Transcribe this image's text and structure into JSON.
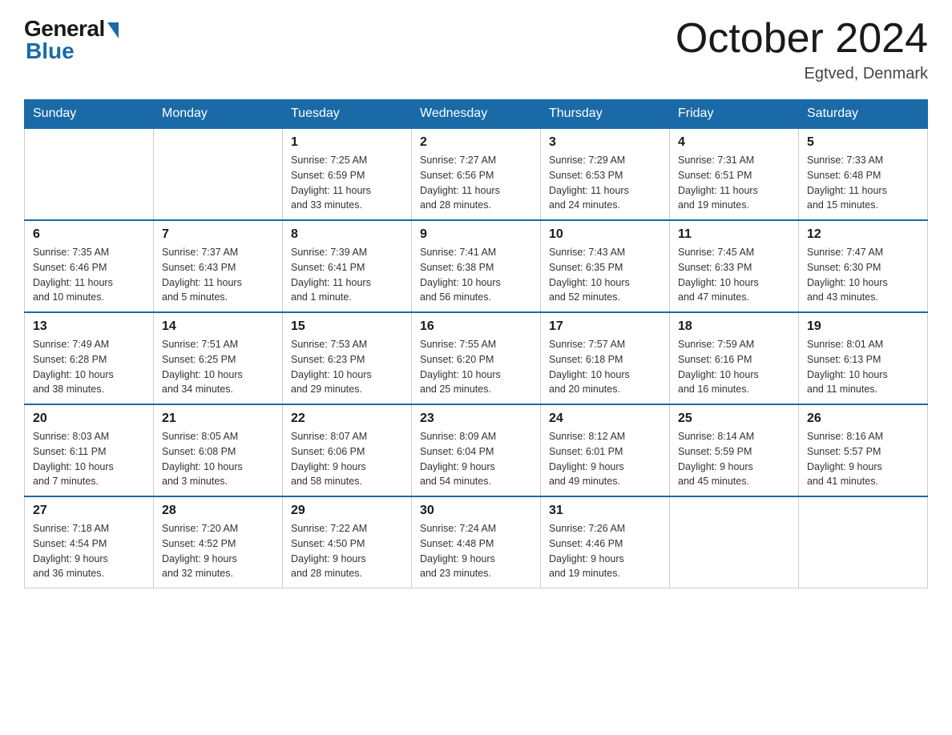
{
  "logo": {
    "general": "General",
    "blue": "Blue"
  },
  "title": "October 2024",
  "location": "Egtved, Denmark",
  "headers": [
    "Sunday",
    "Monday",
    "Tuesday",
    "Wednesday",
    "Thursday",
    "Friday",
    "Saturday"
  ],
  "weeks": [
    [
      {
        "day": "",
        "info": ""
      },
      {
        "day": "",
        "info": ""
      },
      {
        "day": "1",
        "info": "Sunrise: 7:25 AM\nSunset: 6:59 PM\nDaylight: 11 hours\nand 33 minutes."
      },
      {
        "day": "2",
        "info": "Sunrise: 7:27 AM\nSunset: 6:56 PM\nDaylight: 11 hours\nand 28 minutes."
      },
      {
        "day": "3",
        "info": "Sunrise: 7:29 AM\nSunset: 6:53 PM\nDaylight: 11 hours\nand 24 minutes."
      },
      {
        "day": "4",
        "info": "Sunrise: 7:31 AM\nSunset: 6:51 PM\nDaylight: 11 hours\nand 19 minutes."
      },
      {
        "day": "5",
        "info": "Sunrise: 7:33 AM\nSunset: 6:48 PM\nDaylight: 11 hours\nand 15 minutes."
      }
    ],
    [
      {
        "day": "6",
        "info": "Sunrise: 7:35 AM\nSunset: 6:46 PM\nDaylight: 11 hours\nand 10 minutes."
      },
      {
        "day": "7",
        "info": "Sunrise: 7:37 AM\nSunset: 6:43 PM\nDaylight: 11 hours\nand 5 minutes."
      },
      {
        "day": "8",
        "info": "Sunrise: 7:39 AM\nSunset: 6:41 PM\nDaylight: 11 hours\nand 1 minute."
      },
      {
        "day": "9",
        "info": "Sunrise: 7:41 AM\nSunset: 6:38 PM\nDaylight: 10 hours\nand 56 minutes."
      },
      {
        "day": "10",
        "info": "Sunrise: 7:43 AM\nSunset: 6:35 PM\nDaylight: 10 hours\nand 52 minutes."
      },
      {
        "day": "11",
        "info": "Sunrise: 7:45 AM\nSunset: 6:33 PM\nDaylight: 10 hours\nand 47 minutes."
      },
      {
        "day": "12",
        "info": "Sunrise: 7:47 AM\nSunset: 6:30 PM\nDaylight: 10 hours\nand 43 minutes."
      }
    ],
    [
      {
        "day": "13",
        "info": "Sunrise: 7:49 AM\nSunset: 6:28 PM\nDaylight: 10 hours\nand 38 minutes."
      },
      {
        "day": "14",
        "info": "Sunrise: 7:51 AM\nSunset: 6:25 PM\nDaylight: 10 hours\nand 34 minutes."
      },
      {
        "day": "15",
        "info": "Sunrise: 7:53 AM\nSunset: 6:23 PM\nDaylight: 10 hours\nand 29 minutes."
      },
      {
        "day": "16",
        "info": "Sunrise: 7:55 AM\nSunset: 6:20 PM\nDaylight: 10 hours\nand 25 minutes."
      },
      {
        "day": "17",
        "info": "Sunrise: 7:57 AM\nSunset: 6:18 PM\nDaylight: 10 hours\nand 20 minutes."
      },
      {
        "day": "18",
        "info": "Sunrise: 7:59 AM\nSunset: 6:16 PM\nDaylight: 10 hours\nand 16 minutes."
      },
      {
        "day": "19",
        "info": "Sunrise: 8:01 AM\nSunset: 6:13 PM\nDaylight: 10 hours\nand 11 minutes."
      }
    ],
    [
      {
        "day": "20",
        "info": "Sunrise: 8:03 AM\nSunset: 6:11 PM\nDaylight: 10 hours\nand 7 minutes."
      },
      {
        "day": "21",
        "info": "Sunrise: 8:05 AM\nSunset: 6:08 PM\nDaylight: 10 hours\nand 3 minutes."
      },
      {
        "day": "22",
        "info": "Sunrise: 8:07 AM\nSunset: 6:06 PM\nDaylight: 9 hours\nand 58 minutes."
      },
      {
        "day": "23",
        "info": "Sunrise: 8:09 AM\nSunset: 6:04 PM\nDaylight: 9 hours\nand 54 minutes."
      },
      {
        "day": "24",
        "info": "Sunrise: 8:12 AM\nSunset: 6:01 PM\nDaylight: 9 hours\nand 49 minutes."
      },
      {
        "day": "25",
        "info": "Sunrise: 8:14 AM\nSunset: 5:59 PM\nDaylight: 9 hours\nand 45 minutes."
      },
      {
        "day": "26",
        "info": "Sunrise: 8:16 AM\nSunset: 5:57 PM\nDaylight: 9 hours\nand 41 minutes."
      }
    ],
    [
      {
        "day": "27",
        "info": "Sunrise: 7:18 AM\nSunset: 4:54 PM\nDaylight: 9 hours\nand 36 minutes."
      },
      {
        "day": "28",
        "info": "Sunrise: 7:20 AM\nSunset: 4:52 PM\nDaylight: 9 hours\nand 32 minutes."
      },
      {
        "day": "29",
        "info": "Sunrise: 7:22 AM\nSunset: 4:50 PM\nDaylight: 9 hours\nand 28 minutes."
      },
      {
        "day": "30",
        "info": "Sunrise: 7:24 AM\nSunset: 4:48 PM\nDaylight: 9 hours\nand 23 minutes."
      },
      {
        "day": "31",
        "info": "Sunrise: 7:26 AM\nSunset: 4:46 PM\nDaylight: 9 hours\nand 19 minutes."
      },
      {
        "day": "",
        "info": ""
      },
      {
        "day": "",
        "info": ""
      }
    ]
  ]
}
